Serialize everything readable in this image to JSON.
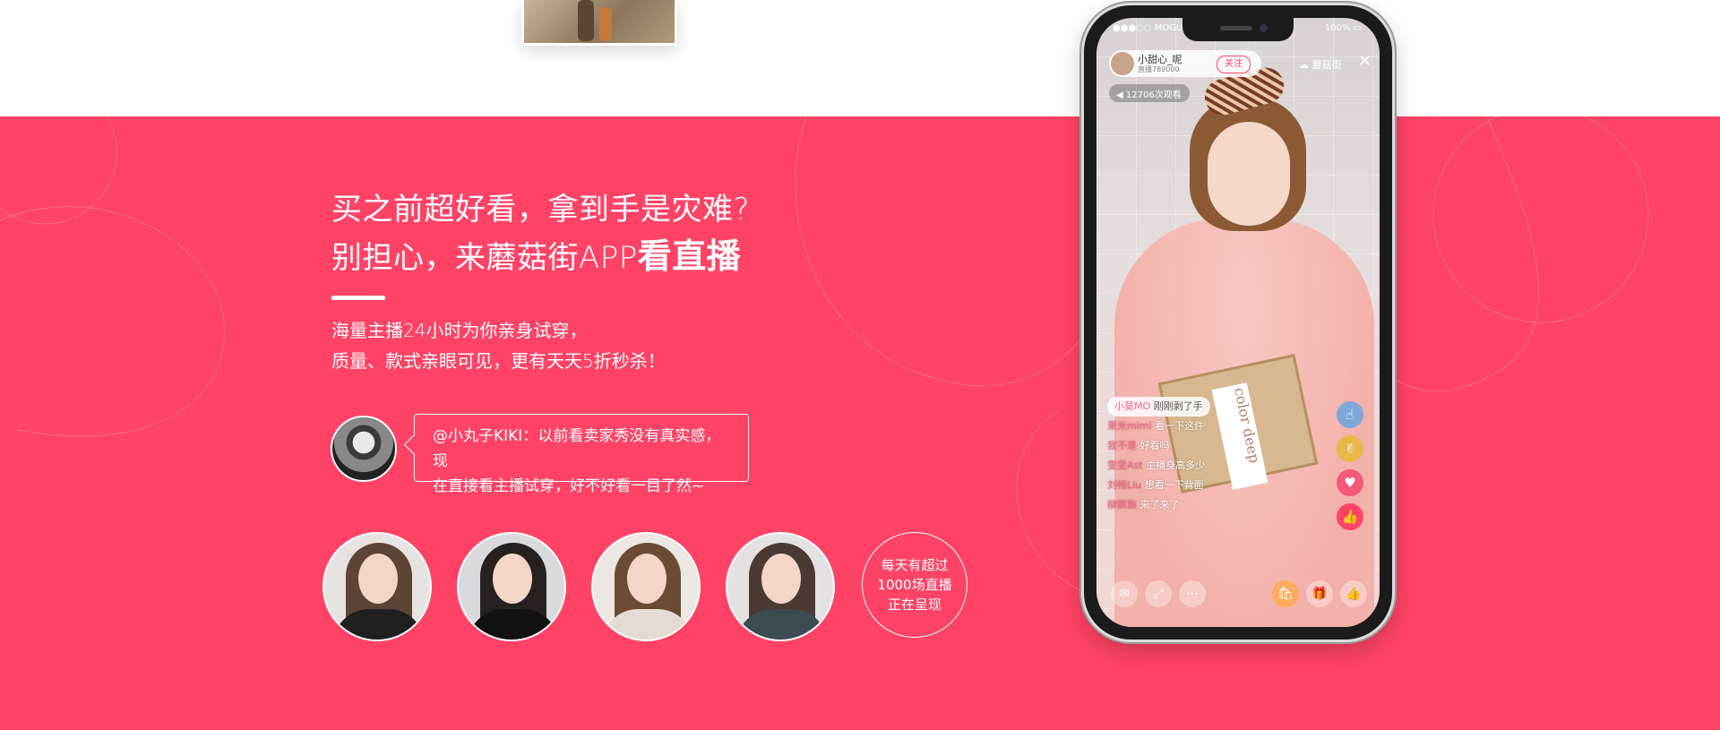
{
  "headline": {
    "line1": "买之前超好看，拿到手是灾难?",
    "line2_prefix": "别担心，来蘑菇街APP",
    "line2_bold": "看直播"
  },
  "subtext": {
    "line1": "海量主播24小时为你亲身试穿，",
    "line2": "质量、款式亲眼可见，更有天天5折秒杀！"
  },
  "testimonial": {
    "line1": "@小丸子KIKI：以前看卖家秀没有真实感，现",
    "line2": "在直接看主播试穿，好不好看一目了然~"
  },
  "stat": {
    "line1": "每天有超过",
    "line2": "1000场直播",
    "line3": "正在呈现"
  },
  "phone": {
    "status": {
      "carrier": "●●●○○ MOGU",
      "battery": "100% ▭"
    },
    "anchor": {
      "name": "小甜心_呢",
      "sub": "直播789000",
      "follow_label": "关注"
    },
    "viewers_label": "☁ 蘑菇街",
    "close_icon": "✕",
    "sound_label": "◀ 12706次观看",
    "box_text": "color deep",
    "chat": [
      {
        "who": "小莫MO",
        "text": "刚刚剥了手",
        "pill": true
      },
      {
        "who": "果米mimi",
        "text": "看一下这件",
        "pill": false
      },
      {
        "who": "我不是",
        "text": "好看吗",
        "pill": false
      },
      {
        "who": "雯雯Ast",
        "text": "主播身高多少",
        "pill": false
      },
      {
        "who": "刘畅Liu",
        "text": "想看一下背面",
        "pill": false
      },
      {
        "who": "柳飘飘",
        "text": "来了来了",
        "pill": false
      }
    ],
    "reactions": [
      "☝",
      "✌",
      "♥",
      "👍"
    ],
    "bottom_icons": [
      "✉",
      "⤢",
      "⋯",
      "🛍",
      "🎁",
      "👍"
    ]
  },
  "colors": {
    "brand_red": "#ff4366",
    "white": "#ffffff"
  }
}
